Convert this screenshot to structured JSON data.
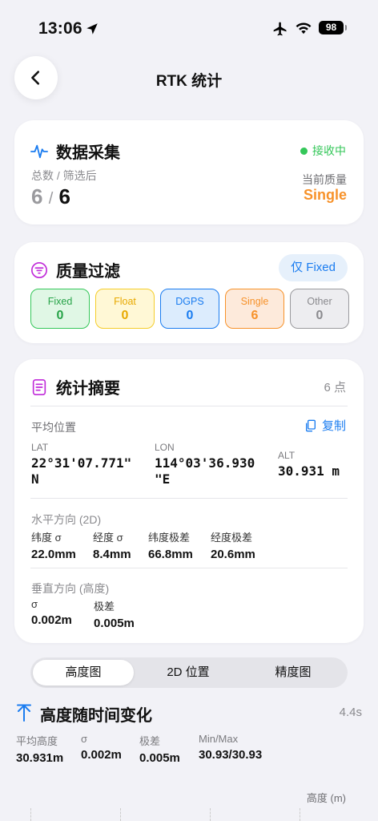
{
  "status": {
    "time": "13:06",
    "battery": "98"
  },
  "nav": {
    "title": "RTK 统计"
  },
  "collection": {
    "title": "数据采集",
    "status_text": "接收中",
    "total_label": "总数 / 筛选后",
    "total": "6",
    "separator": "/",
    "filtered": "6",
    "quality_label": "当前质量",
    "quality_value": "Single"
  },
  "filter": {
    "title": "质量过滤",
    "only_fixed_label": "仅 Fixed",
    "pills": [
      {
        "label": "Fixed",
        "count": "0"
      },
      {
        "label": "Float",
        "count": "0"
      },
      {
        "label": "DGPS",
        "count": "0"
      },
      {
        "label": "Single",
        "count": "6"
      },
      {
        "label": "Other",
        "count": "0"
      }
    ]
  },
  "summary": {
    "title": "统计摘要",
    "points": "6 点",
    "avg_label": "平均位置",
    "copy_label": "复制",
    "lat_label": "LAT",
    "lat_value_1": "22°31'07.771\"",
    "lat_value_2": "N",
    "lon_label": "LON",
    "lon_value_1": "114°03'36.930",
    "lon_value_2": "\"E",
    "alt_label": "ALT",
    "alt_value": "30.931 m",
    "horizontal_label": "水平方向 (2D)",
    "horizontal": [
      {
        "label": "纬度 σ",
        "value": "22.0mm"
      },
      {
        "label": "经度 σ",
        "value": "8.4mm"
      },
      {
        "label": "纬度极差",
        "value": "66.8mm"
      },
      {
        "label": "经度极差",
        "value": "20.6mm"
      }
    ],
    "vertical_label": "垂直方向 (高度)",
    "vertical": [
      {
        "label": "σ",
        "value": "0.002m"
      },
      {
        "label": "极差",
        "value": "0.005m"
      }
    ]
  },
  "tabs": [
    {
      "label": "高度图"
    },
    {
      "label": "2D 位置"
    },
    {
      "label": "精度图"
    }
  ],
  "chart_section": {
    "title": "高度随时间变化",
    "duration": "4.4s",
    "stats": [
      {
        "label": "平均高度",
        "value": "30.931m"
      },
      {
        "label": "σ",
        "value": "0.002m"
      },
      {
        "label": "极差",
        "value": "0.005m"
      },
      {
        "label": "Min/Max",
        "value": "30.93/30.93"
      }
    ],
    "axis_label": "高度 (m)"
  },
  "colors": {
    "accent_blue": "#1a7cf0",
    "green": "#34c759",
    "orange": "#f7922a",
    "purple": "#c02ad9"
  }
}
